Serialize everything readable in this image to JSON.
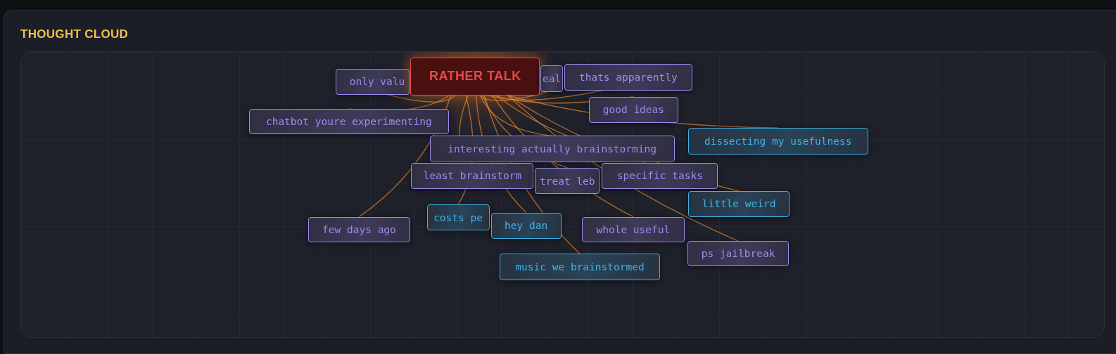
{
  "panel": {
    "title": "THOUGHT CLOUD"
  },
  "cloud": {
    "nodes": [
      {
        "kind": "topic",
        "label": "only valu",
        "color": "#9d8cf0"
      },
      {
        "kind": "central",
        "label": "RATHER TALK",
        "color": "#e8484a"
      },
      {
        "kind": "topic",
        "label": "eal",
        "color": "#9d8cf0"
      },
      {
        "kind": "topic",
        "label": "thats apparently",
        "color": "#9d8cf0"
      },
      {
        "kind": "topic",
        "label": "chatbot youre experimenting",
        "color": "#9d8cf0"
      },
      {
        "kind": "topic",
        "label": "good ideas",
        "color": "#9d8cf0"
      },
      {
        "kind": "topic",
        "label": "interesting actually brainstorming",
        "color": "#9d8cf0"
      },
      {
        "kind": "topic",
        "label": "least brainstorm",
        "color": "#9d8cf0"
      },
      {
        "kind": "topic",
        "label": "treat leb",
        "color": "#9d8cf0"
      },
      {
        "kind": "topic",
        "label": "specific tasks",
        "color": "#9d8cf0"
      },
      {
        "kind": "topic",
        "label": "dissecting my usefulness",
        "color": "#3fb2e6"
      },
      {
        "kind": "topic",
        "label": "little weird",
        "color": "#3fb2e6"
      },
      {
        "kind": "topic",
        "label": "few days ago",
        "color": "#9d8cf0"
      },
      {
        "kind": "topic",
        "label": "costs pe",
        "color": "#3fb2e6"
      },
      {
        "kind": "topic",
        "label": "hey dan",
        "color": "#3fb2e6"
      },
      {
        "kind": "topic",
        "label": "whole useful",
        "color": "#9d8cf0"
      },
      {
        "kind": "topic",
        "label": "ps jailbreak",
        "color": "#9d8cf0"
      },
      {
        "kind": "topic",
        "label": "music we brainstormed",
        "color": "#3fb2e6"
      }
    ]
  }
}
